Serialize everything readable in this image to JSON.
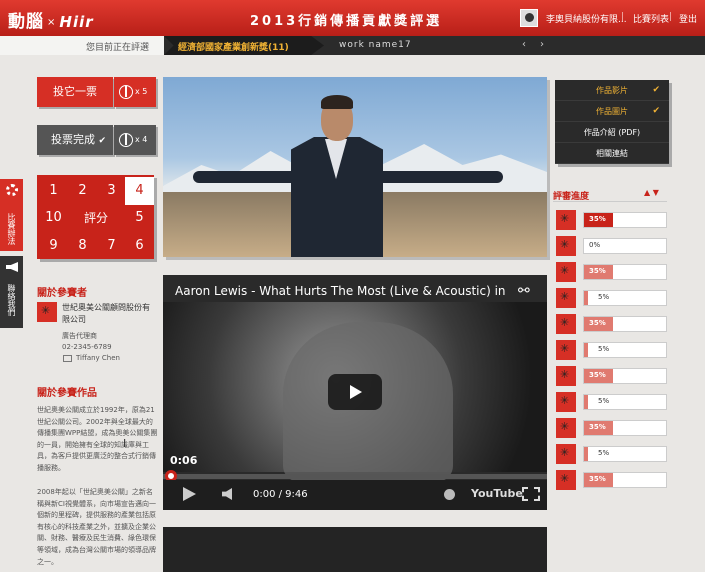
{
  "header": {
    "logo_main": "動腦",
    "logo_x": "×",
    "logo_brand": "Hiir",
    "page_title": "2013行銷傳播貢獻獎評選",
    "company": "李奧貝納股份有限...",
    "sep": "|",
    "nav_list": "比賽列表",
    "nav_logout": "登出"
  },
  "breadcrumb": {
    "label": "您目前正在評選",
    "category": "經濟部國家產業創新獎(11)",
    "work": "work name17",
    "prev": "‹",
    "next": "›"
  },
  "vote": {
    "vote_label": "投它一票",
    "vote_count": "x 5",
    "done_label": "投票完成",
    "done_check": "✔",
    "done_count": "x 4"
  },
  "score": {
    "label": "評分",
    "selected": "4",
    "cells": [
      "1",
      "2",
      "3",
      "4",
      "10",
      "5",
      "9",
      "8",
      "7",
      "6"
    ]
  },
  "side_tabs": {
    "rule": "比賽辦法",
    "contact": "聯絡我們"
  },
  "participant": {
    "title": "關於參賽者",
    "name": "世紀奧美公關顧問股份有限公司",
    "role": "廣告代理商",
    "phone": "02-2345-6789",
    "contact_name": "Tiffany Chen"
  },
  "work_info": {
    "title": "關於參賽作品",
    "para1": "世紀奧美公關成立於1992年，原為21世紀公關公司。2002年與全球最大的傳播集團WPP結盟，成為奧美公關集團的一員，開始擁有全球的知識庫與工具，為客戶提供更廣泛的整合式行銷傳播服務。",
    "para2": "2008年起以「世紀奧美公關」之新名稱與新CI視覺體系，向市場宣告邁向一個新的里程碑，提供服務的產業包括原有核心的科技產業之外，並擴及企業公關、財務、醫療及民生消費、綠色環保等領域，成為台灣公關市場的領導品牌之一。"
  },
  "video": {
    "title": "Aaron Lewis - What Hurts The Most (Live & Acoustic) in [H",
    "current_time_overlay": "0:06",
    "time_display": "0:00 / 9:46",
    "youtube": "YouTube",
    "progress_fraction": 0.01
  },
  "menu": {
    "items": [
      {
        "label": "作品影片",
        "active": true
      },
      {
        "label": "作品圖片",
        "active": true
      },
      {
        "label": "作品介紹 (PDF)",
        "active": false
      },
      {
        "label": "相關連結",
        "active": false
      }
    ],
    "check": "✔"
  },
  "review_progress": {
    "title": "評審進度",
    "arrows": "▲ ▼",
    "rows": [
      {
        "percent": 35,
        "label": "35%"
      },
      {
        "percent": 0,
        "label": "0%"
      },
      {
        "percent": 35,
        "label": "35%"
      },
      {
        "percent": 5,
        "label": "5%"
      },
      {
        "percent": 35,
        "label": "35%"
      },
      {
        "percent": 5,
        "label": "5%"
      },
      {
        "percent": 35,
        "label": "35%"
      },
      {
        "percent": 5,
        "label": "5%"
      },
      {
        "percent": 35,
        "label": "35%"
      },
      {
        "percent": 5,
        "label": "5%"
      },
      {
        "percent": 35,
        "label": "35%"
      }
    ]
  },
  "colors": {
    "brand_red": "#d62f25",
    "accent_gold": "#f0b234",
    "dark": "#2a2a2a"
  }
}
